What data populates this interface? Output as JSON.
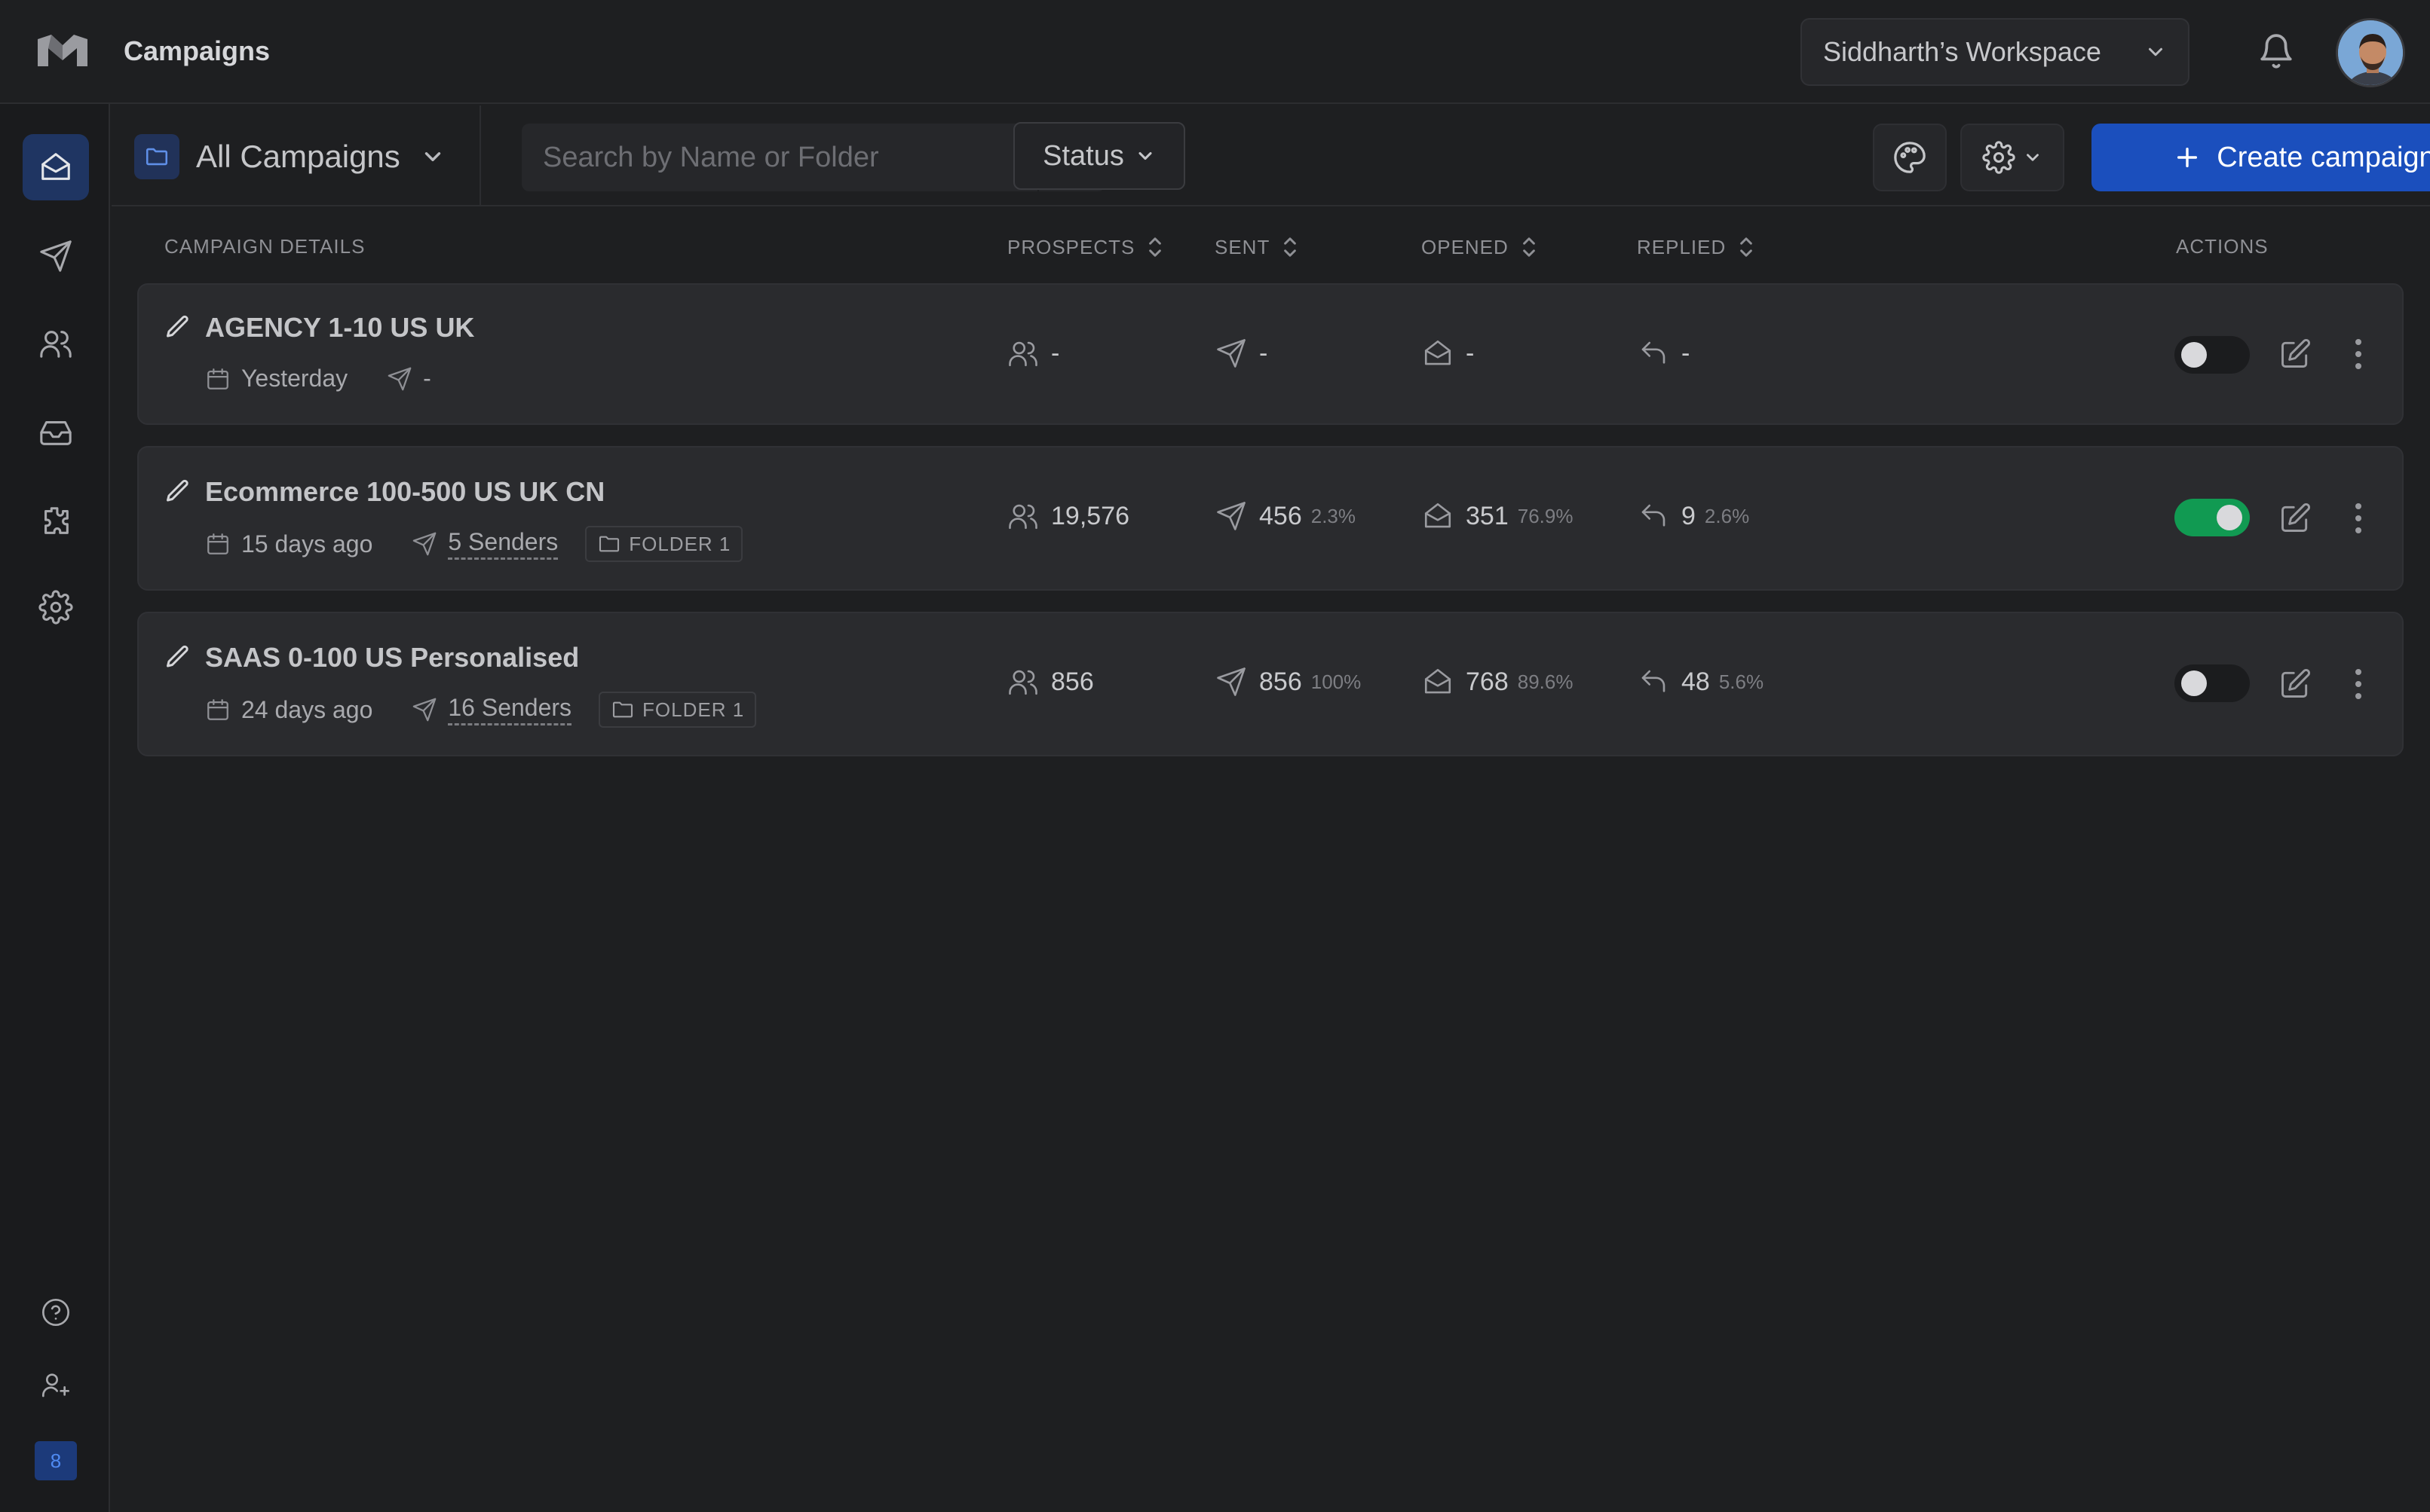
{
  "header": {
    "app_title": "Campaigns",
    "workspace": "Siddharth’s Workspace",
    "icons": [
      "logo-icon",
      "chevron-down-icon",
      "bell-icon",
      "avatar"
    ]
  },
  "sidebar": {
    "items": [
      {
        "name": "campaigns",
        "icon": "mail-open-icon",
        "active": true
      },
      {
        "name": "send",
        "icon": "paper-plane-icon"
      },
      {
        "name": "prospects",
        "icon": "users-icon"
      },
      {
        "name": "inbox",
        "icon": "inbox-icon"
      },
      {
        "name": "integrations",
        "icon": "puzzle-icon"
      },
      {
        "name": "settings",
        "icon": "gear-icon"
      },
      {
        "name": "help",
        "icon": "help-circle-icon"
      },
      {
        "name": "invite",
        "icon": "user-plus-icon"
      }
    ],
    "badge": "8"
  },
  "toolbar": {
    "folder_select": "All Campaigns",
    "search_placeholder": "Search by Name or Folder",
    "status_label": "Status",
    "create_label": "Create campaign"
  },
  "table": {
    "headers": {
      "details": "CAMPAIGN DETAILS",
      "prospects": "PROSPECTS",
      "sent": "SENT",
      "opened": "OPENED",
      "replied": "REPLIED",
      "actions": "ACTIONS"
    },
    "rows": [
      {
        "title": "AGENCY 1-10 US UK",
        "date": "Yesterday",
        "senders": "-",
        "folder": "",
        "prospects": "-",
        "sent": "-",
        "sent_pct": "",
        "opened": "-",
        "opened_pct": "",
        "replied": "-",
        "replied_pct": "",
        "active": false
      },
      {
        "title": "Ecommerce 100-500 US UK CN",
        "date": "15 days ago",
        "senders": "5 Senders",
        "folder": "FOLDER 1",
        "prospects": "19,576",
        "sent": "456",
        "sent_pct": "2.3%",
        "opened": "351",
        "opened_pct": "76.9%",
        "replied": "9",
        "replied_pct": "2.6%",
        "active": true
      },
      {
        "title": "SAAS 0-100 US Personalised",
        "date": "24 days ago",
        "senders": "16 Senders",
        "folder": "FOLDER 1",
        "prospects": "856",
        "sent": "856",
        "sent_pct": "100%",
        "opened": "768",
        "opened_pct": "89.6%",
        "replied": "48",
        "replied_pct": "5.6%",
        "active": false
      }
    ]
  },
  "colors": {
    "background": "#1e1f21",
    "row": "#2a2b2e",
    "accent": "#1b4fbd",
    "toggle_on": "#119a52"
  }
}
